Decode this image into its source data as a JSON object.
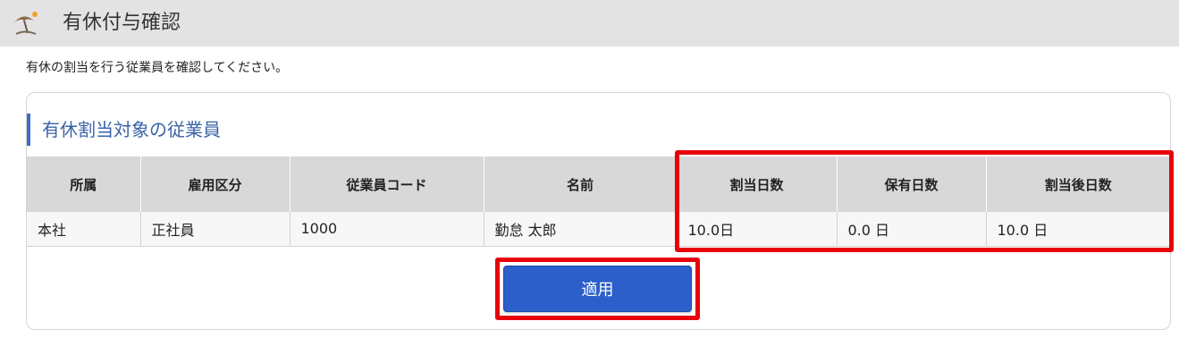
{
  "header": {
    "title": "有休付与確認",
    "icon": "beach-umbrella-icon"
  },
  "intro": {
    "text": "有休の割当を行う従業員を確認してください。"
  },
  "section": {
    "title": "有休割当対象の従業員"
  },
  "table": {
    "headers": [
      "所属",
      "雇用区分",
      "従業員コード",
      "名前",
      "割当日数",
      "保有日数",
      "割当後日数"
    ],
    "rows": [
      [
        "本社",
        "正社員",
        "1000",
        "勤怠 太郎",
        "10.0日",
        "0.0 日",
        "10.0 日"
      ]
    ]
  },
  "actions": {
    "apply_label": "適用"
  },
  "colors": {
    "accent": "#3b6dc7",
    "button": "#2c5fca",
    "highlight": "#e8000b",
    "header_bg": "#e3e3e3"
  }
}
